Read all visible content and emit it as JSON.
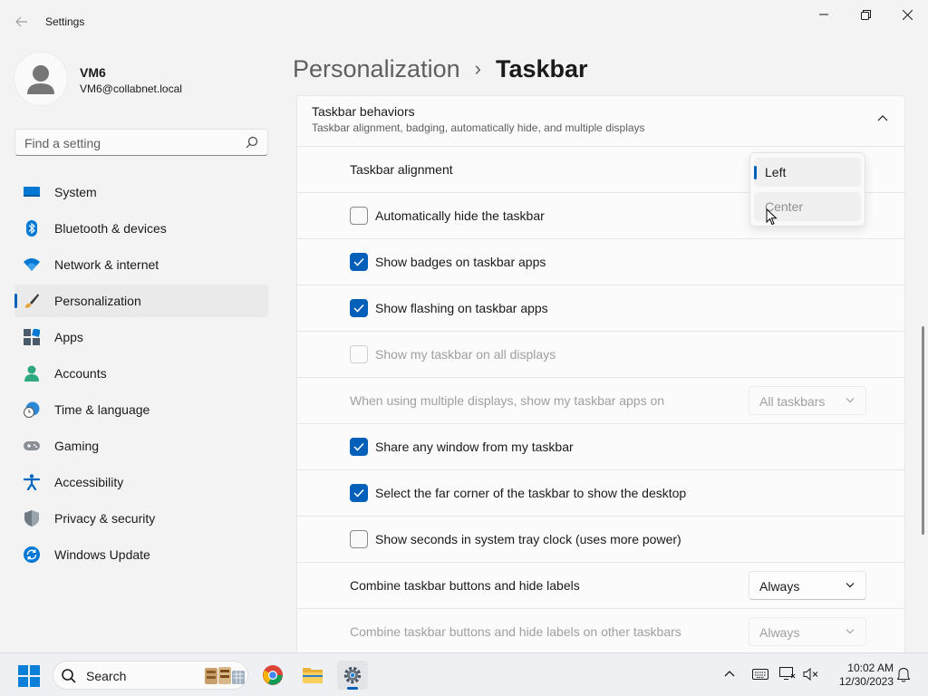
{
  "app": {
    "title": "Settings"
  },
  "user": {
    "name": "VM6",
    "email": "VM6@collabnet.local"
  },
  "search": {
    "placeholder": "Find a setting"
  },
  "sidebar": {
    "items": [
      {
        "label": "System",
        "icon": "system-icon"
      },
      {
        "label": "Bluetooth & devices",
        "icon": "bluetooth-icon"
      },
      {
        "label": "Network & internet",
        "icon": "wifi-icon"
      },
      {
        "label": "Personalization",
        "icon": "brush-icon",
        "active": true
      },
      {
        "label": "Apps",
        "icon": "apps-icon"
      },
      {
        "label": "Accounts",
        "icon": "accounts-icon"
      },
      {
        "label": "Time & language",
        "icon": "time-language-icon"
      },
      {
        "label": "Gaming",
        "icon": "gamepad-icon"
      },
      {
        "label": "Accessibility",
        "icon": "accessibility-icon"
      },
      {
        "label": "Privacy & security",
        "icon": "shield-icon"
      },
      {
        "label": "Windows Update",
        "icon": "update-icon"
      }
    ]
  },
  "breadcrumb": {
    "parent": "Personalization",
    "separator": "›",
    "current": "Taskbar"
  },
  "section": {
    "title": "Taskbar behaviors",
    "subtitle": "Taskbar alignment, badging, automatically hide, and multiple displays"
  },
  "settings": {
    "alignment": {
      "label": "Taskbar alignment",
      "options": [
        "Left",
        "Center"
      ],
      "selected": "Left"
    },
    "autohide": {
      "label": "Automatically hide the taskbar",
      "checked": false
    },
    "badges": {
      "label": "Show badges on taskbar apps",
      "checked": true
    },
    "flashing": {
      "label": "Show flashing on taskbar apps",
      "checked": true
    },
    "all_displays": {
      "label": "Show my taskbar on all displays",
      "checked": false,
      "disabled": true
    },
    "multi_display_apps": {
      "label": "When using multiple displays, show my taskbar apps on",
      "value": "All taskbars",
      "disabled": true
    },
    "share_window": {
      "label": "Share any window from my taskbar",
      "checked": true
    },
    "far_corner": {
      "label": "Select the far corner of the taskbar to show the desktop",
      "checked": true
    },
    "seconds": {
      "label": "Show seconds in system tray clock (uses more power)",
      "checked": false
    },
    "combine": {
      "label": "Combine taskbar buttons and hide labels",
      "value": "Always"
    },
    "combine_other": {
      "label": "Combine taskbar buttons and hide labels on other taskbars",
      "value": "Always",
      "disabled": true
    }
  },
  "taskbar": {
    "search_label": "Search",
    "time": "10:02 AM",
    "date": "12/30/2023"
  },
  "colors": {
    "accent": "#005fb8",
    "background": "#f3f3f3",
    "card": "#fbfbfb"
  }
}
